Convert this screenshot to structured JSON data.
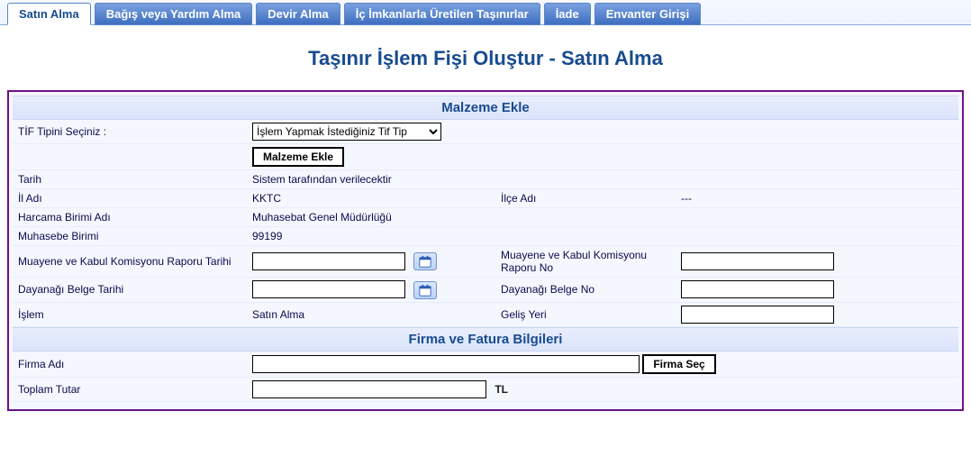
{
  "tabs": [
    {
      "label": "Satın Alma",
      "active": true
    },
    {
      "label": "Bağış veya Yardım Alma",
      "active": false
    },
    {
      "label": "Devir Alma",
      "active": false
    },
    {
      "label": "İç İmkanlarla Üretilen Taşınırlar",
      "active": false
    },
    {
      "label": "İade",
      "active": false
    },
    {
      "label": "Envanter Girişi",
      "active": false
    }
  ],
  "title": "Taşınır İşlem Fişi Oluştur - Satın Alma",
  "sections": {
    "malzeme_header": "Malzeme Ekle",
    "firma_header": "Firma ve Fatura Bilgileri"
  },
  "labels": {
    "tif_tipi": "TİF Tipini Seçiniz :",
    "malzeme_ekle_btn": "Malzeme Ekle",
    "tarih": "Tarih",
    "il_adi": "İl Adı",
    "ilce_adi": "İlçe Adı",
    "harcama_birimi": "Harcama Birimi Adı",
    "muhasebe_birimi": "Muhasebe Birimi",
    "muayene_tarih": "Muayene ve Kabul Komisyonu Raporu Tarihi",
    "muayene_no": "Muayene ve Kabul Komisyonu Raporu No",
    "dayanak_tarih": "Dayanağı Belge Tarihi",
    "dayanak_no": "Dayanağı Belge No",
    "islem": "İşlem",
    "gelis_yeri": "Geliş Yeri",
    "firma_adi": "Firma Adı",
    "firma_sec_btn": "Firma Seç",
    "toplam_tutar": "Toplam Tutar",
    "currency": "TL"
  },
  "values": {
    "tif_tipi_selected": "İşlem Yapmak İstediğiniz Tif Tip",
    "tarih_note": "Sistem tarafından verilecektir",
    "il_adi": "KKTC",
    "ilce_adi": "---",
    "harcama_birimi": "Muhasebat Genel Müdürlüğü",
    "muhasebe_birimi": "99199",
    "muayene_tarih": "",
    "muayene_no": "",
    "dayanak_tarih": "",
    "dayanak_no": "",
    "islem": "Satın Alma",
    "gelis_yeri": "",
    "firma_adi": "",
    "toplam_tutar": ""
  }
}
